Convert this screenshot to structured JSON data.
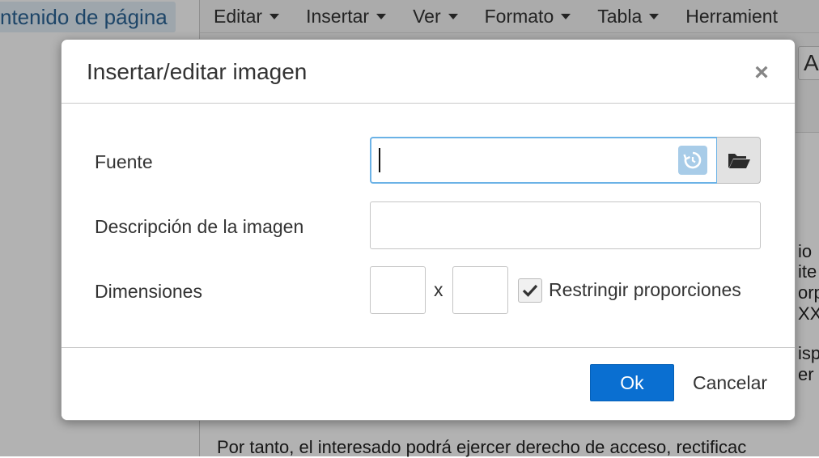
{
  "background": {
    "page_label": "ntenido de página",
    "menu": [
      {
        "label": "Editar"
      },
      {
        "label": "Insertar"
      },
      {
        "label": "Ver"
      },
      {
        "label": "Formato"
      },
      {
        "label": "Tabla"
      },
      {
        "label": "Herramient"
      }
    ],
    "toolbar_partial_button": "A",
    "doc_fragments": [
      "io ",
      "ite",
      "orp",
      "XX",
      "ispu",
      "er P"
    ],
    "doc_bottom_line": "Por tanto, el interesado podrá ejercer derecho de acceso, rectificac"
  },
  "dialog": {
    "title": "Insertar/editar imagen",
    "close_symbol": "×",
    "source_label": "Fuente",
    "source_value": "",
    "description_label": "Descripción de la imagen",
    "description_value": "",
    "dimensions_label": "Dimensiones",
    "width_value": "",
    "height_value": "",
    "dimension_separator": "x",
    "constrain_label": "Restringir proporciones",
    "constrain_checked": true,
    "ok_label": "Ok",
    "cancel_label": "Cancelar"
  },
  "colors": {
    "accent": "#0a6fd1",
    "focus_border": "#6bb2e6",
    "recent_icon_bg": "#a8cce8"
  },
  "icons": {
    "recent": "history-icon",
    "browse": "folder-open-icon",
    "check": "checkmark-icon",
    "close": "close-icon"
  }
}
